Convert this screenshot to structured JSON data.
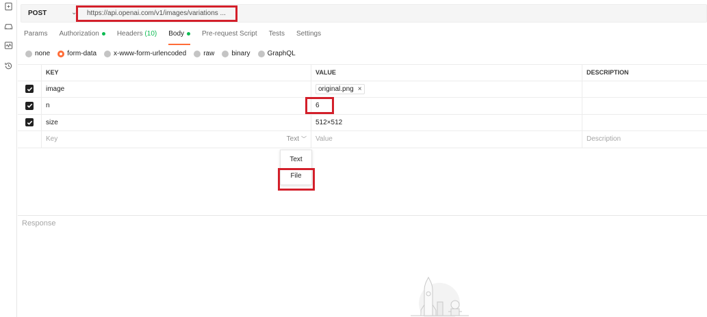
{
  "request": {
    "method": "POST",
    "url": "https://api.openai.com/v1/images/variations ..."
  },
  "tabs": [
    {
      "label": "Params"
    },
    {
      "label": "Authorization"
    },
    {
      "label": "Headers",
      "count": "(10)"
    },
    {
      "label": "Body"
    },
    {
      "label": "Pre-request Script"
    },
    {
      "label": "Tests"
    },
    {
      "label": "Settings"
    }
  ],
  "body_types": [
    {
      "label": "none"
    },
    {
      "label": "form-data"
    },
    {
      "label": "x-www-form-urlencoded"
    },
    {
      "label": "raw"
    },
    {
      "label": "binary"
    },
    {
      "label": "GraphQL"
    }
  ],
  "table": {
    "headers": {
      "key": "KEY",
      "value": "VALUE",
      "description": "DESCRIPTION"
    },
    "rows": [
      {
        "key": "image",
        "value": "original.png",
        "remove": "×"
      },
      {
        "key": "n",
        "value": "6"
      },
      {
        "key": "size",
        "value": "512×512"
      }
    ],
    "new_row": {
      "key_placeholder": "Key",
      "type": "Text",
      "value_placeholder": "Value",
      "description_placeholder": "Description"
    }
  },
  "type_dropdown": {
    "options": [
      "Text",
      "File"
    ]
  },
  "response": {
    "label": "Response"
  },
  "colors": {
    "accent": "#ff6c37",
    "highlight": "#d31f2a",
    "ok": "#0cbb52"
  },
  "icons": [
    "new-request-icon",
    "environment-icon",
    "monitor-icon",
    "history-icon",
    "check-icon",
    "chevron-down-icon",
    "close-icon"
  ]
}
